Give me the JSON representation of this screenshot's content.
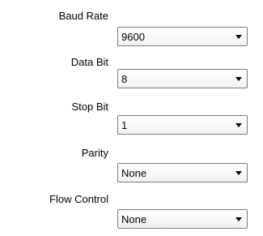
{
  "settings": [
    {
      "label": "Baud Rate",
      "value": "9600",
      "icon": "chevron-down-icon"
    },
    {
      "label": "Data Bit",
      "value": "8",
      "icon": "chevron-down-icon"
    },
    {
      "label": "Stop Bit",
      "value": "1",
      "icon": "chevron-down-icon"
    },
    {
      "label": "Parity",
      "value": "None",
      "icon": "chevron-down-icon"
    },
    {
      "label": "Flow Control",
      "value": "None",
      "icon": "chevron-down-icon"
    }
  ]
}
